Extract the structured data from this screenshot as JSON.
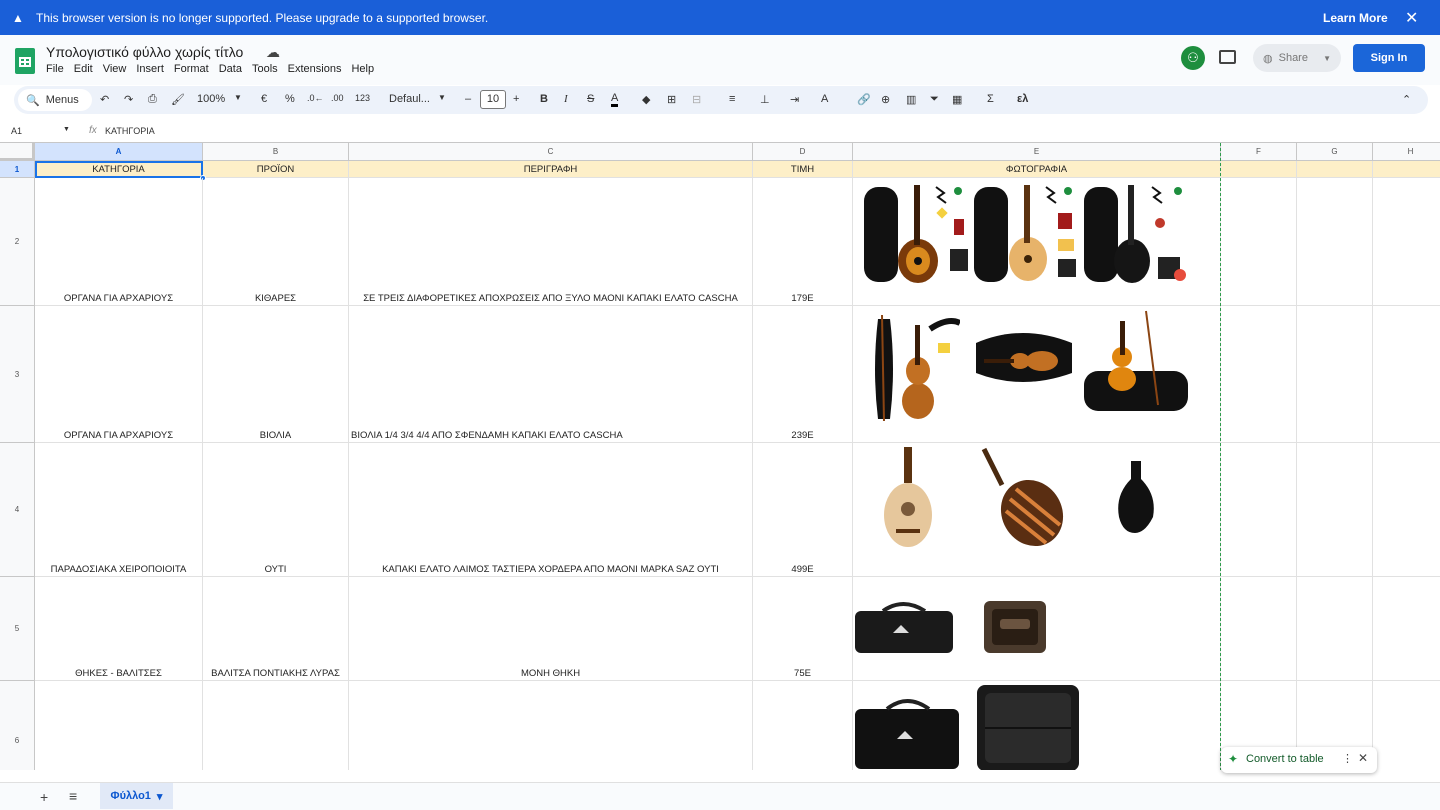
{
  "banner": {
    "message": "This browser version is no longer supported. Please upgrade to a supported browser.",
    "learn_more": "Learn More",
    "close": "✕",
    "warn": "▲"
  },
  "doc": {
    "title": "Υπολογιστικό φύλλο χωρίς τίτλο",
    "cloud": "☁"
  },
  "menu": {
    "file": "File",
    "edit": "Edit",
    "view": "View",
    "insert": "Insert",
    "format": "Format",
    "data": "Data",
    "tools": "Tools",
    "extensions": "Extensions",
    "help": "Help"
  },
  "header_right": {
    "avatar": "⚇",
    "share": "Share",
    "signin": "Sign In"
  },
  "toolbar": {
    "menus": "Menus",
    "search": "🔍",
    "undo": "↶",
    "redo": "↷",
    "print": "⎙",
    "paint": "🖌",
    "zoom": "100%",
    "currency": "€",
    "percent": "%",
    "dec_down": ".0←",
    "dec_up": ".00",
    "number_fmt": "123",
    "font": "Defaul...",
    "minus": "–",
    "font_size": "10",
    "plus": "+",
    "bold": "B",
    "italic": "I",
    "strike": "S",
    "text_color": "A",
    "fill": "◆",
    "borders": "⊞",
    "merge": "⊟",
    "align": "≡",
    "valign": "⊥",
    "wrap": "⇥",
    "rotate": "A",
    "link": "🔗",
    "comment": "⊕",
    "chart": "▥",
    "filter": "⏷",
    "filter_views": "▦",
    "sum": "Σ",
    "lambda": "ελ",
    "collapse": "⌃"
  },
  "formula": {
    "cell_ref": "A1",
    "fx": "fx",
    "value": "ΚΑΤΗΓΟΡΙΑ"
  },
  "columns": [
    "A",
    "B",
    "C",
    "D",
    "E",
    "F",
    "G",
    "H"
  ],
  "rows_numbers": [
    "1",
    "2",
    "3",
    "4",
    "5",
    "6"
  ],
  "header_row": {
    "a": "ΚΑΤΗΓΟΡΙΑ",
    "b": "ΠΡΟΪΟΝ",
    "c": "ΠΕΡΙΓΡΑΦΗ",
    "d": "ΤΙΜΗ",
    "e": "ΦΩΤΟΓΡΑΦΙΑ"
  },
  "rows": [
    {
      "category": "ΟΡΓΑΝΑ ΓΙΑ ΑΡΧΑΡΙΟΥΣ",
      "product": "ΚΙΘΑΡΕΣ",
      "description": "ΣΕ ΤΡΕΙΣ ΔΙΑΦΟΡΕΤΙΚΕΣ ΑΠΟΧΡΩΣΕΙΣ ΑΠΟ ΞΥΛΟ ΜΑΟΝΙ ΚΑΠΑΚΙ ΕΛΑΤΟ CASCHA",
      "price": "179E"
    },
    {
      "category": "ΟΡΓΑΝΑ ΓΙΑ ΑΡΧΑΡΙΟΥΣ",
      "product": "ΒΙΟΛΙΑ",
      "description": "ΒΙΟΛΙΑ 1/4 3/4 4/4 ΑΠΟ ΣΦΕΝΔΑΜΗ ΚΑΠΑΚΙ ΕΛΑΤΟ CASCHA",
      "price": "239E"
    },
    {
      "category": "ΠΑΡΑΔΟΣΙΑΚΑ ΧΕΙΡΟΠΟΙΟΙΤΑ",
      "product": "ΟΥΤΙ",
      "description": "ΚΑΠΑΚΙ ΕΛΑΤΟ ΛΑΙΜΟΣ ΤΑΣΤΙΕΡΑ ΧΟΡΔΕΡΑ ΑΠΟ ΜΑΟΝΙ ΜΑΡΚΑ SAZ ΟΥΤΙ",
      "price": "499E"
    },
    {
      "category": "ΘΗΚΕΣ - ΒΑΛΙΤΣΕΣ",
      "product": "ΒΑΛΙΤΣΑ ΠΟΝΤΙΑΚΗΣ ΛΥΡΑΣ",
      "description": "ΜΟΝΗ ΘΗΚΗ",
      "price": "75E"
    },
    {
      "category": "",
      "product": "",
      "description": "",
      "price": ""
    }
  ],
  "sheet": {
    "add": "+",
    "list": "≡",
    "tab": "Φύλλο1",
    "caret": "▾"
  },
  "convert": {
    "spark": "✦",
    "label": "Convert to table",
    "more": "⋮",
    "close": "✕"
  },
  "colors": {
    "banner": "#1a5fd8",
    "header_fill": "#fdefc8",
    "signin": "#1b66d9",
    "accent": "#0b57d0"
  }
}
